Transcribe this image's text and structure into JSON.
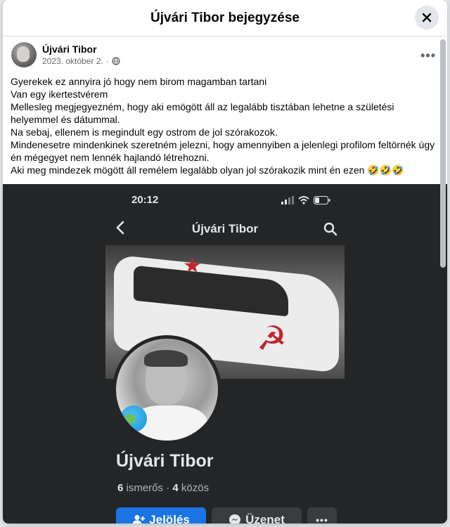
{
  "dialog": {
    "title": "Újvári Tibor bejegyzése",
    "close_icon": "close-icon"
  },
  "post": {
    "author": "Újvári Tibor",
    "date": "2023. október 2.",
    "audience_icon": "globe-icon",
    "more_icon": "ellipsis-icon",
    "more_label": "•••",
    "text_lines": [
      "Gyerekek ez annyira jó hogy nem birom magamban tartani",
      "Van egy ikertestvérem",
      "Mellesleg megjegyezném, hogy aki emögött áll az legalább tisztában lehetne a születési helyemmel és dátummal.",
      "Na sebaj, ellenem is megindult egy ostrom de jol szórakozok.",
      "Mindenesetre mindenkinek szeretném jelezni, hogy amennyiben a jelenlegi profilom feltörnék úgy én mégegyet nem lennék hajlandó létrehozni.",
      "Aki meg mindezek mögött áll remélem legalább olyan jol szórakozik mint én ezen 🤣🤣🤣"
    ]
  },
  "screenshot": {
    "status_time": "20:12",
    "nav_title": "Újvári Tibor",
    "profile_name": "Újvári Tibor",
    "friends_count": "6",
    "friends_label": "ismerős",
    "separator": "·",
    "mutual_count": "4",
    "mutual_label": "közös",
    "buttons": {
      "add_friend": "Jelölés",
      "message": "Üzenet",
      "more": "•••"
    },
    "colors": {
      "primary": "#1b74e4",
      "dark_bg": "#242526",
      "secondary_btn": "#3a3b3c"
    }
  }
}
